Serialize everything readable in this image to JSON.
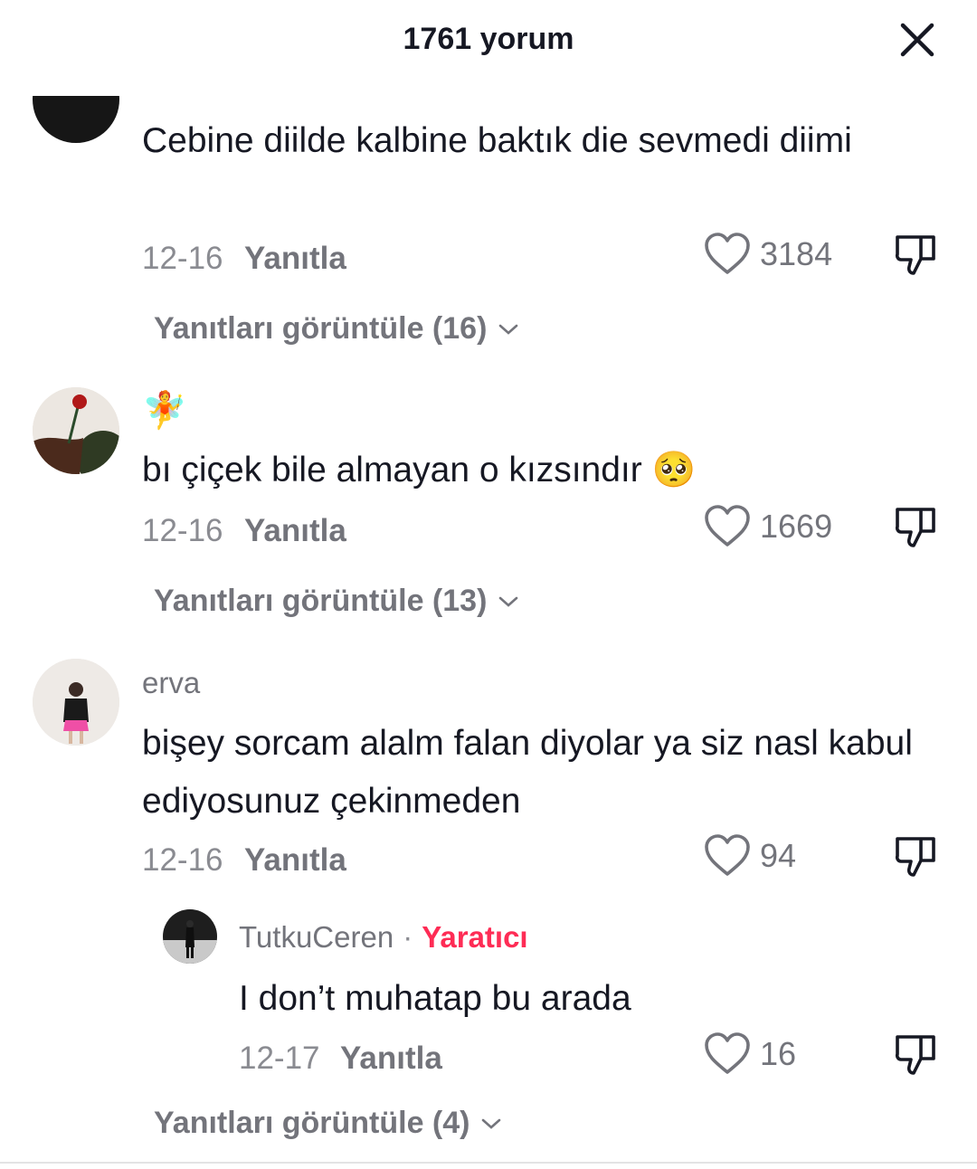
{
  "header": {
    "title": "1761 yorum"
  },
  "comments": [
    {
      "username": "",
      "text": "Cebine diilde kalbine baktık die sevmedi diimi",
      "date": "12-16",
      "reply_label": "Yanıtla",
      "likes": "3184",
      "view_replies": "Yanıtları görüntüle (16)"
    },
    {
      "username": "🧚",
      "text": "bı çiçek bile almayan o kızsındır 🥺",
      "date": "12-16",
      "reply_label": "Yanıtla",
      "likes": "1669",
      "view_replies": "Yanıtları görüntüle (13)"
    },
    {
      "username": "erva",
      "text": "bişey sorcam alalm falan diyolar ya siz nasl kabul ediyosunuz çekinmeden",
      "date": "12-16",
      "reply_label": "Yanıtla",
      "likes": "94",
      "reply": {
        "username": "TutkuCeren",
        "separator": "·",
        "badge": "Yaratıcı",
        "text": "I don’t muhatap bu arada",
        "date": "12-17",
        "reply_label": "Yanıtla",
        "likes": "16"
      },
      "view_replies": "Yanıtları görüntüle (4)"
    }
  ],
  "colors": {
    "accent": "#fe2c55",
    "text": "#161823",
    "muted": "#73747b"
  },
  "icons": {
    "close": "close-icon",
    "like": "heart-outline-icon",
    "dislike": "thumbs-down-icon",
    "expand": "chevron-down-icon"
  }
}
